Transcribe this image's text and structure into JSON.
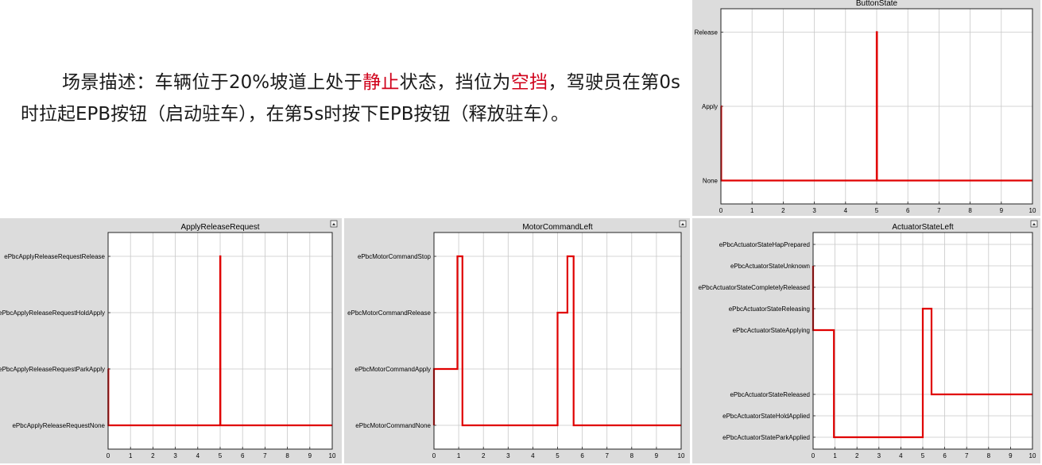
{
  "description": {
    "parts": [
      {
        "text": "场景描述：车辆位于20%坡道上处于",
        "highlight": false
      },
      {
        "text": "静止",
        "highlight": true
      },
      {
        "text": "状态，挡位为",
        "highlight": false
      },
      {
        "text": "空挡",
        "highlight": true
      },
      {
        "text": "，驾驶员在第0s时拉起EPB按钮（启动驻车），在第5s时按下EPB按钮（释放驻车）。",
        "highlight": false
      }
    ],
    "highlight_color": "#d0021b"
  },
  "line_color": "#e00000",
  "chart_data": [
    {
      "id": "button-state",
      "type": "line",
      "title": "ButtonState",
      "xlabel": "",
      "ylabel": "",
      "xlim": [
        0,
        10
      ],
      "x_ticks": [
        0,
        1,
        2,
        3,
        4,
        5,
        6,
        7,
        8,
        9,
        10
      ],
      "y_levels": [
        "None",
        "Apply",
        "Release"
      ],
      "grid": true,
      "undock_button": false,
      "series": [
        {
          "x": [
            0,
            0,
            0.01,
            0.01,
            5,
            5,
            5.01,
            5.01,
            10
          ],
          "y": [
            1,
            1,
            1,
            0,
            0,
            2,
            2,
            0,
            0
          ]
        }
      ]
    },
    {
      "id": "apply-release-request",
      "type": "line",
      "title": "ApplyReleaseRequest",
      "xlabel": "",
      "ylabel": "",
      "xlim": [
        0,
        10
      ],
      "x_ticks": [
        0,
        1,
        2,
        3,
        4,
        5,
        6,
        7,
        8,
        9,
        10
      ],
      "y_levels": [
        "ePbcApplyReleaseRequestNone",
        "ePbcApplyReleaseRequestParkApply",
        "ePbcApplyReleaseRequestHoldApply",
        "ePbcApplyReleaseRequestRelease"
      ],
      "grid": true,
      "undock_button": true,
      "series": [
        {
          "x": [
            0,
            0.01,
            0.01,
            5,
            5,
            5.01,
            5.01,
            10
          ],
          "y": [
            1,
            1,
            0,
            0,
            3,
            3,
            0,
            0
          ]
        }
      ]
    },
    {
      "id": "motor-command-left",
      "type": "line",
      "title": "MotorCommandLeft",
      "xlabel": "",
      "ylabel": "",
      "xlim": [
        0,
        10
      ],
      "x_ticks": [
        0,
        1,
        2,
        3,
        4,
        5,
        6,
        7,
        8,
        9,
        10
      ],
      "y_levels": [
        "ePbcMotorCommandNone",
        "ePbcMotorCommandApply",
        "ePbcMotorCommandRelease",
        "ePbcMotorCommandStop"
      ],
      "grid": true,
      "undock_button": true,
      "series": [
        {
          "x": [
            0,
            0,
            0.95,
            0.95,
            1.15,
            1.15,
            5.0,
            5.0,
            5.4,
            5.4,
            5.65,
            5.65,
            10
          ],
          "y": [
            0,
            1,
            1,
            3,
            3,
            0,
            0,
            2,
            2,
            3,
            3,
            0,
            0
          ]
        }
      ]
    },
    {
      "id": "actuator-state-left",
      "type": "line",
      "title": "ActuatorStateLeft",
      "xlabel": "",
      "ylabel": "",
      "xlim": [
        0,
        10
      ],
      "x_ticks": [
        0,
        1,
        2,
        3,
        4,
        5,
        6,
        7,
        8,
        9,
        10
      ],
      "y_levels": [
        "ePbcActuatorStateParkApplied",
        "ePbcActuatorStateHoldApplied",
        "ePbcActuatorStateReleased",
        "",
        "",
        "ePbcActuatorStateApplying",
        "ePbcActuatorStateReleasing",
        "ePbcActuatorStateCompletelyReleased",
        "ePbcActuatorStateUnknown",
        "ePbcActuatorStateHapPrepared"
      ],
      "grid": true,
      "undock_button": true,
      "series": [
        {
          "x": [
            0,
            0,
            0.02,
            0.02,
            0.95,
            0.95,
            5.0,
            5.0,
            5.4,
            5.4,
            10
          ],
          "y": [
            8,
            5,
            5,
            5,
            5,
            0,
            0,
            6,
            6,
            2,
            2
          ]
        }
      ]
    }
  ]
}
